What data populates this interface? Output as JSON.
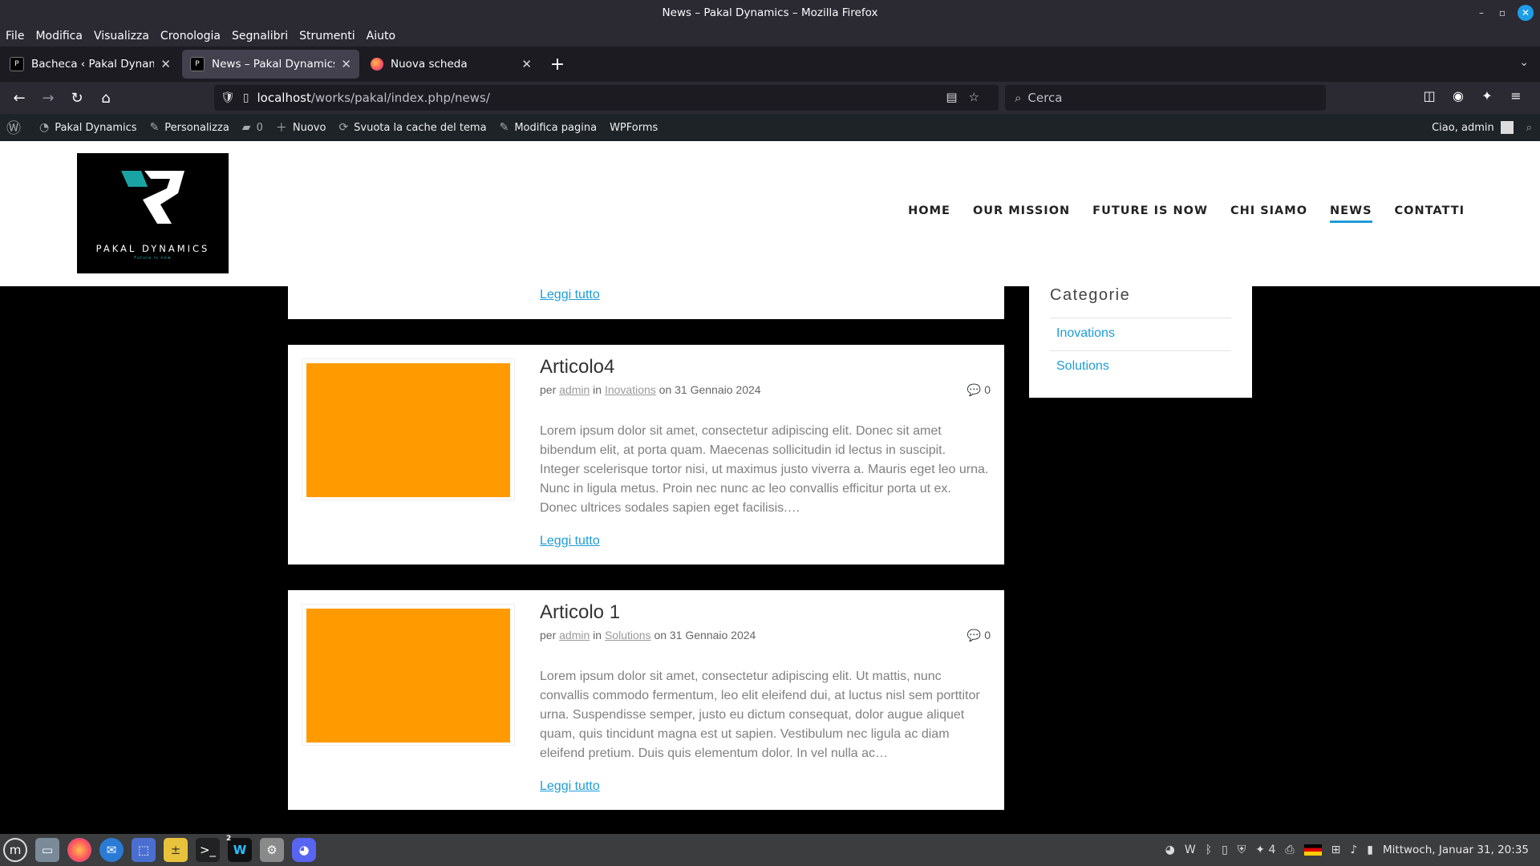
{
  "window": {
    "title": "News – Pakal Dynamics – Mozilla Firefox"
  },
  "menubar": [
    "File",
    "Modifica",
    "Visualizza",
    "Cronologia",
    "Segnalibri",
    "Strumenti",
    "Aiuto"
  ],
  "tabs": [
    {
      "label": "Bacheca ‹ Pakal Dynamics —",
      "active": false
    },
    {
      "label": "News – Pakal Dynamics",
      "active": true
    },
    {
      "label": "Nuova scheda",
      "active": false
    }
  ],
  "url": {
    "host": "localhost",
    "path": "/works/pakal/index.php/news/"
  },
  "search": {
    "placeholder": "Cerca"
  },
  "adminbar": {
    "site": "Pakal Dynamics",
    "customize": "Personalizza",
    "comments_count": "0",
    "new": "Nuovo",
    "cache": "Svuota la cache del tema",
    "edit": "Modifica pagina",
    "wpforms": "WPForms",
    "greeting": "Ciao, admin"
  },
  "logo": {
    "brand": "PAKAL DYNAMICS",
    "tagline": "Future is now"
  },
  "nav": {
    "items": [
      "HOME",
      "OUR MISSION",
      "FUTURE IS NOW",
      "CHI SIAMO",
      "NEWS",
      "CONTATTI"
    ],
    "current": "NEWS",
    "accent": "#1e9cd7"
  },
  "read_more": "Leggi tutto",
  "posts": [
    {
      "title": "Articolo4",
      "by": "per",
      "author": "admin",
      "in": "in",
      "category": "Inovations",
      "date": "on 31 Gennaio 2024",
      "comments": "0",
      "excerpt": "Lorem ipsum dolor sit amet, consectetur adipiscing elit. Donec sit amet bibendum elit, at porta quam. Maecenas sollicitudin id lectus in suscipit. Integer scelerisque tortor nisi, ut maximus justo viverra a. Mauris eget leo urna. Nunc in ligula metus. Proin nec nunc ac leo convallis efficitur porta ut ex. Donec ultrices sodales sapien eget facilisis.…",
      "thumb_color": "#ff9b00"
    },
    {
      "title": "Articolo 1",
      "by": "per",
      "author": "admin",
      "in": "in",
      "category": "Solutions",
      "date": "on 31 Gennaio 2024",
      "comments": "0",
      "excerpt": "Lorem ipsum dolor sit amet, consectetur adipiscing elit. Ut mattis, nunc convallis commodo fermentum, leo elit eleifend dui, at luctus nisl sem porttitor urna. Suspendisse semper, justo eu dictum consequat, dolor augue aliquet quam, quis tincidunt magna est ut sapien. Vestibulum nec ligula ac diam eleifend pretium. Duis quis elementum dolor. In vel nulla ac…",
      "thumb_color": "#ff9b00"
    }
  ],
  "sidebar": {
    "title": "Categorie",
    "categories": [
      "Inovations",
      "Solutions"
    ]
  },
  "taskbar": {
    "workspace_badge": "2",
    "notifications": "4",
    "clock": "Mittwoch, Januar 31, 20:35"
  }
}
